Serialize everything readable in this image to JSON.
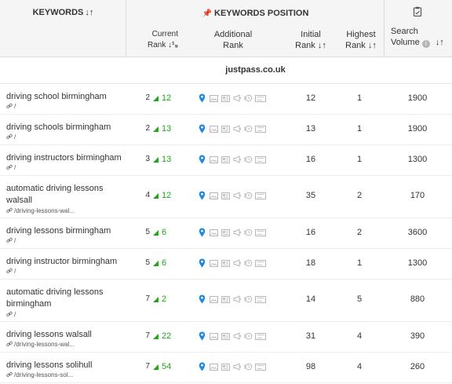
{
  "header": {
    "keywords": "KEYWORDS",
    "keywords_position": "KEYWORDS POSITION",
    "current_rank_1": "Current",
    "current_rank_2": "Rank",
    "additional_rank_1": "Additional",
    "additional_rank_2": "Rank",
    "initial_rank_1": "Initial",
    "initial_rank_2": "Rank",
    "highest_rank_1": "Highest",
    "highest_rank_2": "Rank",
    "search_volume_1": "Search",
    "search_volume_2": "Volume"
  },
  "site": "justpass.co.uk",
  "colors": {
    "up": "#21a51b",
    "pin": "#1e88e5",
    "icon_gray": "#b8b8b8"
  },
  "rows": [
    {
      "keyword_line1": "driving school birmingham",
      "keyword_line2": "",
      "url": "/",
      "current": "2",
      "change": "12",
      "initial": "12",
      "highest": "1",
      "volume": "1900"
    },
    {
      "keyword_line1": "driving schools birmingham",
      "keyword_line2": "",
      "url": "/",
      "current": "2",
      "change": "13",
      "initial": "13",
      "highest": "1",
      "volume": "1900"
    },
    {
      "keyword_line1": "driving instructors birmingham",
      "keyword_line2": "",
      "url": "/",
      "current": "3",
      "change": "13",
      "initial": "16",
      "highest": "1",
      "volume": "1300"
    },
    {
      "keyword_line1": "automatic driving lessons",
      "keyword_line2": "walsall",
      "url": "/driving-lessons-wal...",
      "current": "4",
      "change": "12",
      "initial": "35",
      "highest": "2",
      "volume": "170"
    },
    {
      "keyword_line1": "driving lessons birmingham",
      "keyword_line2": "",
      "url": "/",
      "current": "5",
      "change": "6",
      "initial": "16",
      "highest": "2",
      "volume": "3600"
    },
    {
      "keyword_line1": "driving instructor birmingham",
      "keyword_line2": "",
      "url": "/",
      "current": "5",
      "change": "6",
      "initial": "18",
      "highest": "1",
      "volume": "1300"
    },
    {
      "keyword_line1": "automatic driving lessons",
      "keyword_line2": "birmingham",
      "url": "/",
      "current": "7",
      "change": "2",
      "initial": "14",
      "highest": "5",
      "volume": "880"
    },
    {
      "keyword_line1": "driving lessons walsall",
      "keyword_line2": "",
      "url": "/driving-lessons-wal...",
      "current": "7",
      "change": "22",
      "initial": "31",
      "highest": "4",
      "volume": "390"
    },
    {
      "keyword_line1": "driving lessons solihull",
      "keyword_line2": "",
      "url": "/driving-lessons-sol...",
      "current": "7",
      "change": "54",
      "initial": "98",
      "highest": "4",
      "volume": "260"
    }
  ],
  "icons": {
    "sort": "sort-arrows-icon",
    "pin": "map-pin-icon",
    "clipboard": "clipboard-icon",
    "info": "info-icon",
    "link": "link-icon",
    "up": "rank-up-triangle-icon",
    "features": [
      "map-pin-icon",
      "image-icon",
      "featured-snippet-icon",
      "news-megaphone-icon",
      "clock-review-icon",
      "video-icon"
    ]
  }
}
